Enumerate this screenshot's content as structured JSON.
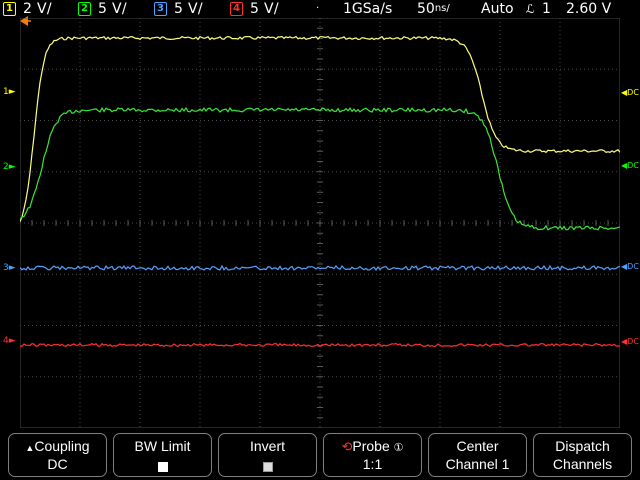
{
  "channels": [
    {
      "num": "1",
      "scale": "2 V/",
      "color": "#ffff00"
    },
    {
      "num": "2",
      "scale": "5 V/",
      "color": "#00ff00"
    },
    {
      "num": "3",
      "scale": "5 V/",
      "color": "#4aa3ff"
    },
    {
      "num": "4",
      "scale": "5 V/",
      "color": "#ff3030"
    }
  ],
  "status": {
    "separator": "·",
    "sample_rate": "1GSa/s",
    "timebase": "50",
    "timebase_unit": "ns/",
    "trigger_mode": "Auto",
    "trigger_glyph": "ℒ",
    "trigger_source": "1",
    "trigger_level": "2.60 V"
  },
  "markers": {
    "ch1": "1",
    "ch2": "2",
    "ch3": "3",
    "ch4": "4",
    "dc1": "DC",
    "dc2": "DC",
    "dc3": "DC",
    "dc4": "DC"
  },
  "softkeys": {
    "coupling": {
      "label": "Coupling",
      "value": "DC",
      "arrow": "▲"
    },
    "bw_limit": {
      "label": "BW Limit"
    },
    "invert": {
      "label": "Invert"
    },
    "probe": {
      "label": "Probe",
      "value": "1:1",
      "info": "①"
    },
    "center": {
      "label": "Center",
      "value": "Channel 1"
    },
    "dispatch": {
      "label": "Dispatch",
      "value": "Channels"
    }
  }
}
